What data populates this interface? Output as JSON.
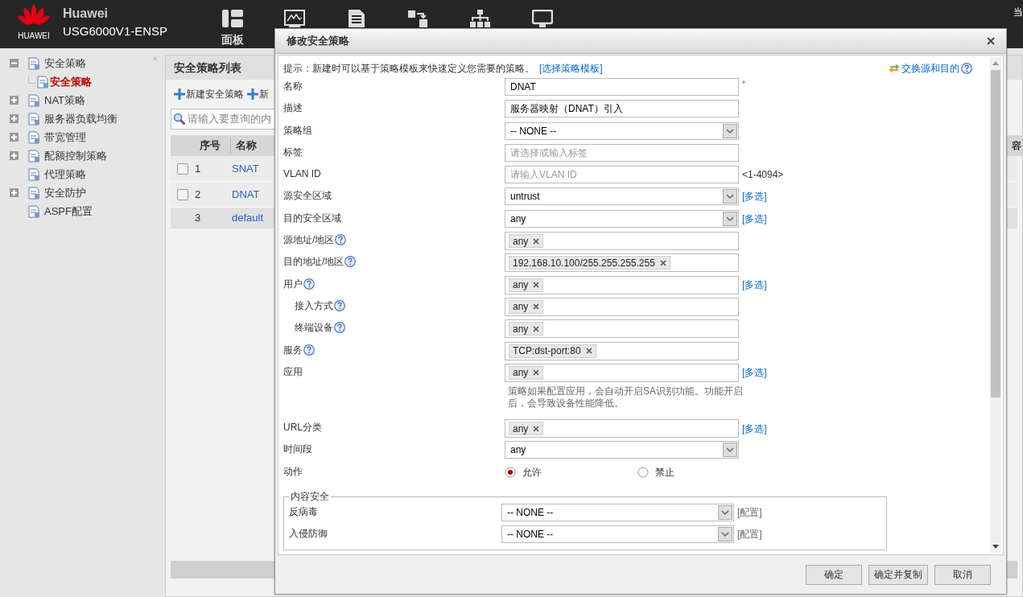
{
  "header": {
    "logo_text": "HUAWEI",
    "brand": "Huawei",
    "model": "USG6000V1-ENSP",
    "corner_text": "当",
    "nav": [
      {
        "kind": "dashboard",
        "label": "面板"
      },
      {
        "kind": "monitor"
      },
      {
        "kind": "document"
      },
      {
        "kind": "transfer"
      },
      {
        "kind": "network"
      },
      {
        "kind": "display"
      }
    ]
  },
  "sidebar": {
    "collapse_glyph": "«",
    "items": [
      {
        "label": "安全策略",
        "kind": "folder",
        "expanded": true,
        "selected": false,
        "children": [
          {
            "label": "安全策略",
            "kind": "leaf",
            "selected": true
          }
        ]
      },
      {
        "label": "NAT策略",
        "kind": "folder",
        "expanded": false,
        "selected": false
      },
      {
        "label": "服务器负载均衡",
        "kind": "folder",
        "expanded": false,
        "selected": false
      },
      {
        "label": "带宽管理",
        "kind": "folder",
        "expanded": false,
        "selected": false
      },
      {
        "label": "配额控制策略",
        "kind": "folder",
        "expanded": false,
        "selected": false
      },
      {
        "label": "代理策略",
        "kind": "leaf",
        "selected": false
      },
      {
        "label": "安全防护",
        "kind": "folder",
        "expanded": false,
        "selected": false
      },
      {
        "label": "ASPF配置",
        "kind": "leaf",
        "selected": false
      }
    ]
  },
  "panel": {
    "title": "安全策略列表",
    "toolbar": [
      "新建安全策略",
      "新"
    ],
    "search": {
      "placeholder": "请输入要查询的内"
    },
    "table": {
      "columns": [
        "序号",
        "名称"
      ],
      "column_3": "容",
      "rows": [
        {
          "kind": "policy",
          "checked": false,
          "number": "1",
          "name": "SNAT"
        },
        {
          "kind": "policy",
          "checked": false,
          "number": "2",
          "name": "DNAT"
        },
        {
          "kind": "default",
          "number": "3",
          "name": "default"
        }
      ]
    }
  },
  "dialog": {
    "title": "修改安全策略",
    "hint": "提示：新建时可以基于策略模板来快速定义您需要的策略。",
    "hint_link": "[选择策略模板]",
    "swap_link": "交换源和目的",
    "required_mark": "*",
    "fields": [
      {
        "label": "名称",
        "kind": "text",
        "help": false,
        "value": "DNAT",
        "required": true
      },
      {
        "label": "描述",
        "kind": "text",
        "help": false,
        "value": "服务器映射（DNAT）引入"
      },
      {
        "label": "策略组",
        "kind": "select",
        "help": false,
        "value": "-- NONE --"
      },
      {
        "label": "标签",
        "kind": "text",
        "help": false,
        "placeholder": "请选择或输入标签"
      },
      {
        "label": "VLAN ID",
        "kind": "text",
        "help": false,
        "placeholder": "请输入VLAN ID",
        "suffix": "<1-4094>"
      },
      {
        "label": "源安全区域",
        "kind": "select",
        "help": false,
        "value": "untrust",
        "link": "[多选]"
      },
      {
        "label": "目的安全区域",
        "kind": "select",
        "help": false,
        "value": "any",
        "link": "[多选]"
      },
      {
        "label": "源地址/地区",
        "kind": "tags",
        "help": true,
        "tags": [
          "any"
        ]
      },
      {
        "label": "目的地址/地区",
        "kind": "tags",
        "help": true,
        "tags": [
          "192.168.10.100/255.255.255.255"
        ]
      },
      {
        "label": "用户",
        "kind": "tags",
        "help": true,
        "tags": [
          "any"
        ],
        "link": "[多选]",
        "children": [
          {
            "label": "接入方式",
            "kind": "tags",
            "help": true,
            "tags": [
              "any"
            ]
          },
          {
            "label": "终端设备",
            "kind": "tags",
            "help": true,
            "tags": [
              "any"
            ]
          }
        ]
      },
      {
        "label": "服务",
        "kind": "tags",
        "help": true,
        "tags": [
          "TCP:dst-port:80"
        ]
      },
      {
        "label": "应用",
        "kind": "tags",
        "help": false,
        "tags": [
          "any"
        ],
        "link": "[多选]",
        "note": "策略如果配置应用，会自动开启SA识别功能。功能开启后，会导致设备性能降低。"
      },
      {
        "label": "URL分类",
        "kind": "tags",
        "help": false,
        "tags": [
          "any"
        ],
        "link": "[多选]"
      },
      {
        "label": "时间段",
        "kind": "select",
        "help": false,
        "value": "any"
      },
      {
        "label": "动作",
        "kind": "radio",
        "help": false,
        "options": [
          {
            "label": "允许",
            "selected": true
          },
          {
            "label": "禁止",
            "selected": false
          }
        ]
      }
    ],
    "content_security": {
      "legend": "内容安全",
      "fields": [
        {
          "label": "反病毒",
          "kind": "select",
          "help": false,
          "value": "-- NONE --",
          "link": "[配置]"
        },
        {
          "label": "入侵防御",
          "kind": "select",
          "help": false,
          "value": "-- NONE --",
          "link": "[配置]"
        }
      ]
    },
    "buttons": [
      "确定",
      "确定并复制",
      "取消"
    ]
  }
}
